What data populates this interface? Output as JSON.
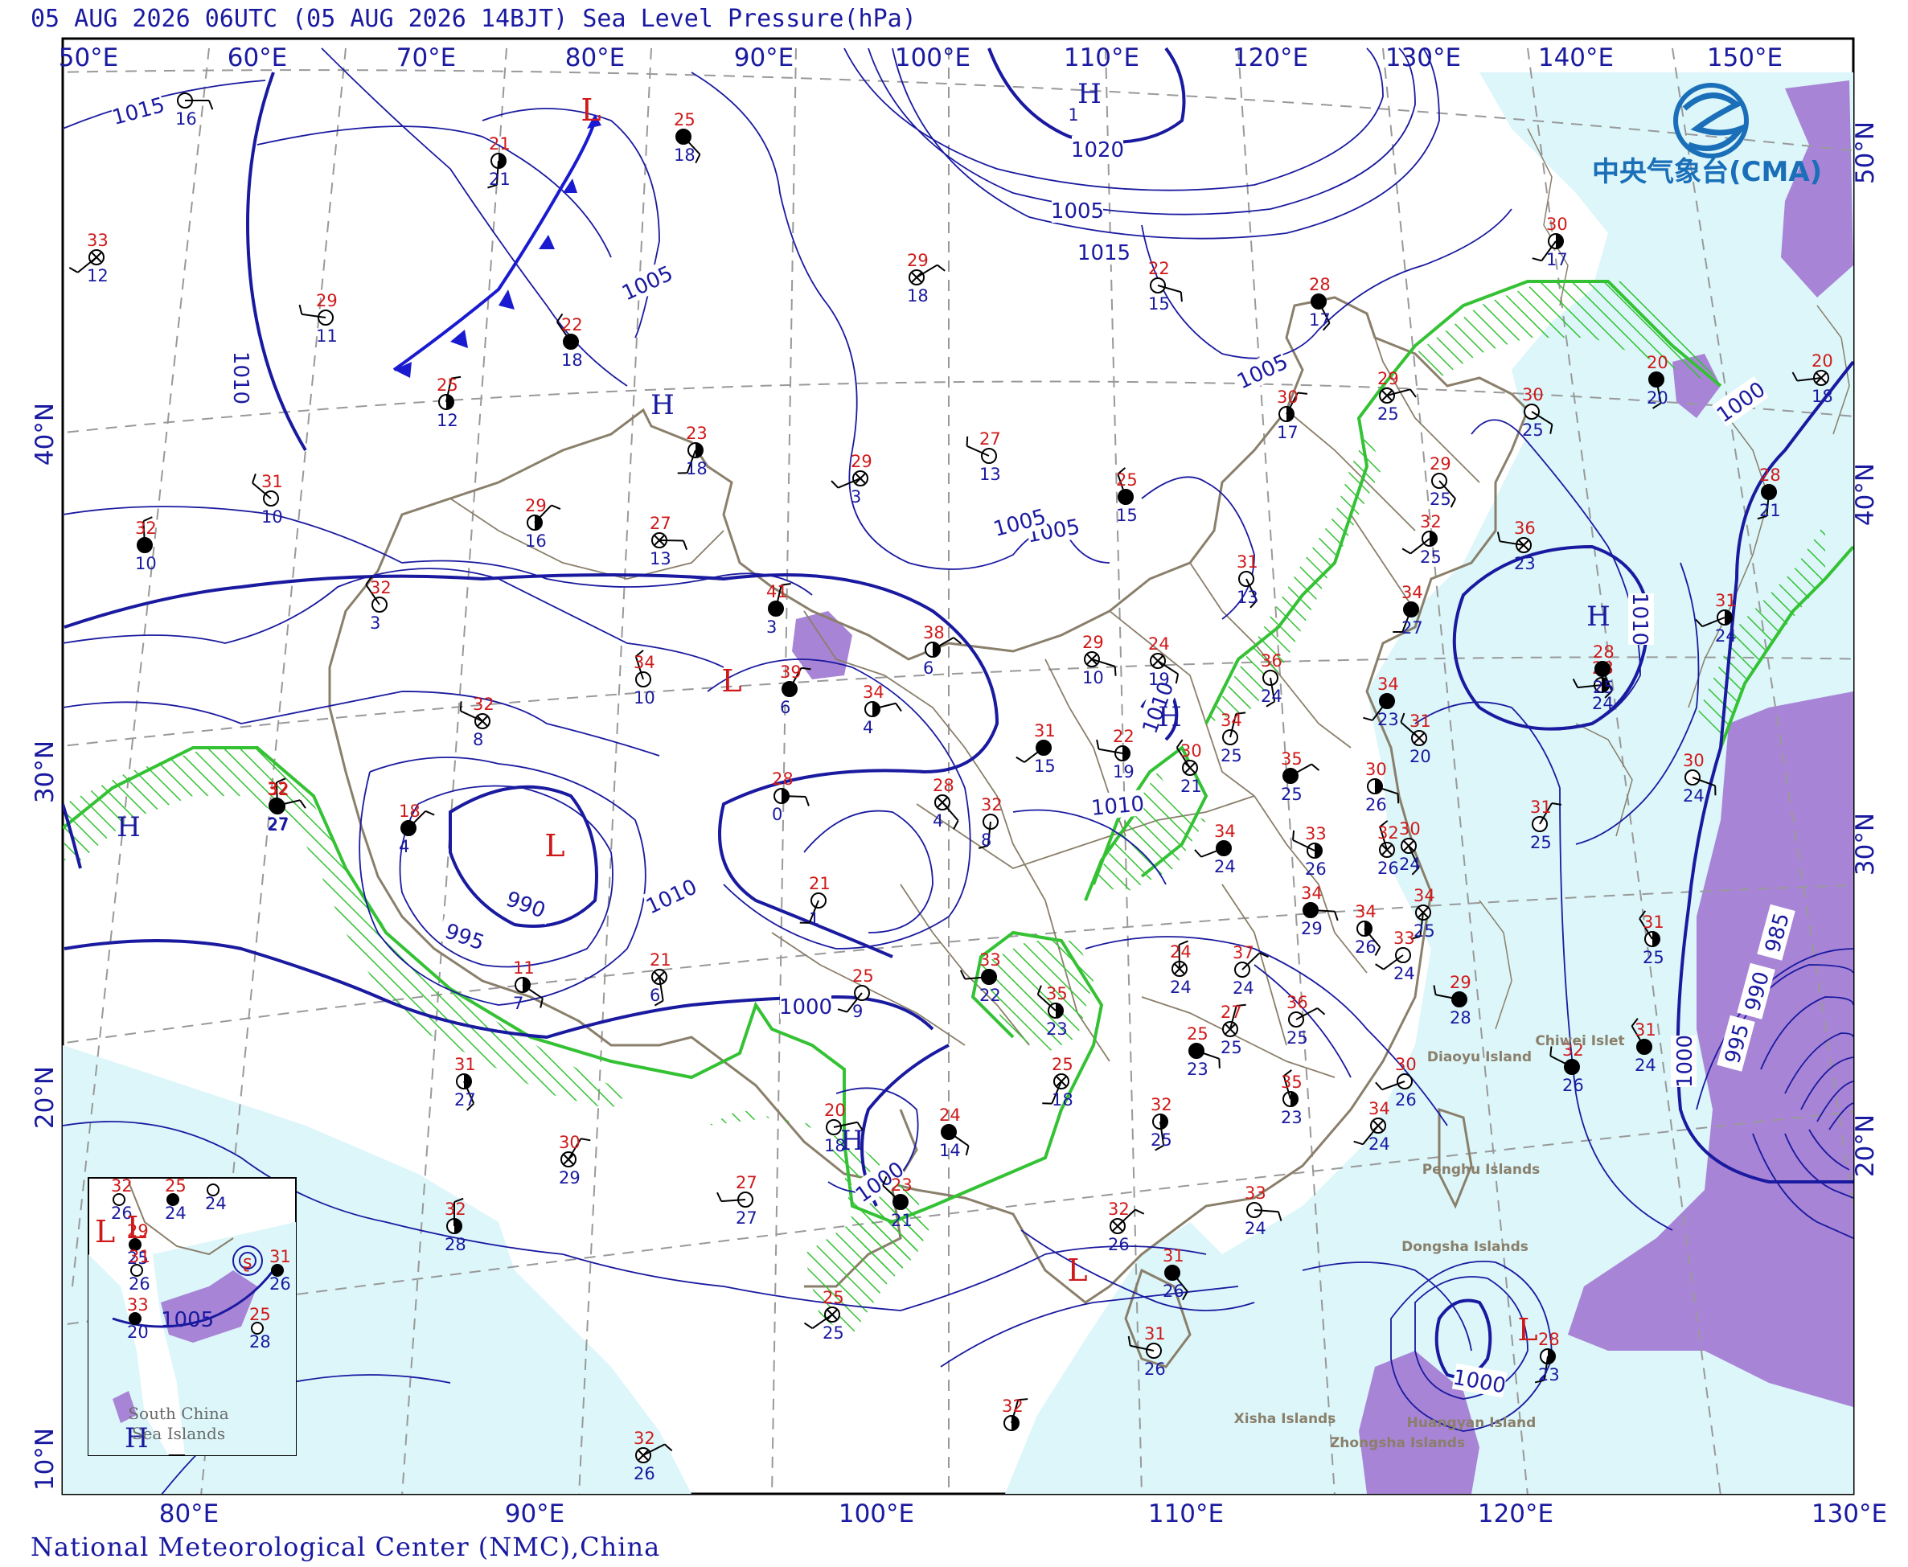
{
  "header": {
    "title": "05 AUG 2026 06UTC (05 AUG 2026 14BJT) Sea Level Pressure(hPa)"
  },
  "footer": {
    "credit": "National Meteorological Center (NMC),China"
  },
  "logo": {
    "text": "中央气象台(CMA)",
    "icon": "cma-emblem-icon"
  },
  "axes": {
    "top_lon": [
      "50°E",
      "60°E",
      "70°E",
      "80°E",
      "90°E",
      "100°E",
      "110°E",
      "120°E",
      "130°E",
      "140°E",
      "150°E"
    ],
    "bottom_lon": [
      "80°E",
      "90°E",
      "100°E",
      "110°E",
      "120°E",
      "130°E"
    ],
    "left_lat": [
      "10°N",
      "20°N",
      "30°N",
      "40°N"
    ],
    "right_lat": [
      "20°N",
      "30°N",
      "40°N",
      "50°N"
    ]
  },
  "isobar_labels": [
    "1015",
    "1010",
    "1005",
    "1020",
    "1015",
    "1010",
    "1005",
    "1005",
    "1010",
    "1010",
    "990",
    "995",
    "1000",
    "1000",
    "1005",
    "1000",
    "1000",
    "995",
    "990",
    "985",
    "1010",
    "1000",
    "1005"
  ],
  "pressure_centers": [
    {
      "type": "L",
      "value": ""
    },
    {
      "type": "H",
      "value": "1"
    },
    {
      "type": "H",
      "value": ""
    },
    {
      "type": "L",
      "value": ""
    },
    {
      "type": "L",
      "value": ""
    },
    {
      "type": "H",
      "value": ""
    },
    {
      "type": "H",
      "value": ""
    },
    {
      "type": "H",
      "value": ""
    },
    {
      "type": "L",
      "value": ""
    },
    {
      "type": "H",
      "value": ""
    },
    {
      "type": "L",
      "value": ""
    },
    {
      "type": "L",
      "value": ""
    }
  ],
  "stations": [
    {
      "t": "",
      "d": "16"
    },
    {
      "t": "25",
      "d": "18"
    },
    {
      "t": "21",
      "d": "21"
    },
    {
      "t": "33",
      "d": "12"
    },
    {
      "t": "29",
      "d": "11"
    },
    {
      "t": "22",
      "d": "18"
    },
    {
      "t": "25",
      "d": "12"
    },
    {
      "t": "29",
      "d": "18"
    },
    {
      "t": "22",
      "d": "15"
    },
    {
      "t": "28",
      "d": "17"
    },
    {
      "t": "23",
      "d": "18"
    },
    {
      "t": "29",
      "d": "3"
    },
    {
      "t": "27",
      "d": "13"
    },
    {
      "t": "25",
      "d": "15"
    },
    {
      "t": "30",
      "d": "17"
    },
    {
      "t": "29",
      "d": "25"
    },
    {
      "t": "30",
      "d": "25"
    },
    {
      "t": "20",
      "d": "20"
    },
    {
      "t": "30",
      "d": "17"
    },
    {
      "t": "20",
      "d": "18"
    },
    {
      "t": "31",
      "d": "10"
    },
    {
      "t": "32",
      "d": "10"
    },
    {
      "t": "29",
      "d": "16"
    },
    {
      "t": "27",
      "d": "13"
    },
    {
      "t": "29",
      "d": "25"
    },
    {
      "t": "28",
      "d": "21"
    },
    {
      "t": "32",
      "d": "25"
    },
    {
      "t": "36",
      "d": "23"
    },
    {
      "t": "32",
      "d": "3"
    },
    {
      "t": "41",
      "d": "3"
    },
    {
      "t": "38",
      "d": "6"
    },
    {
      "t": "29",
      "d": "10"
    },
    {
      "t": "31",
      "d": "13"
    },
    {
      "t": "34",
      "d": "27"
    },
    {
      "t": "31",
      "d": "24"
    },
    {
      "t": "32",
      "d": "8"
    },
    {
      "t": "34",
      "d": "10"
    },
    {
      "t": "39",
      "d": "6"
    },
    {
      "t": "34",
      "d": "4"
    },
    {
      "t": "24",
      "d": "19"
    },
    {
      "t": "36",
      "d": "24"
    },
    {
      "t": "34",
      "d": "23"
    },
    {
      "t": "28",
      "d": "24"
    },
    {
      "t": "31",
      "d": "20"
    },
    {
      "t": "32",
      "d": "27"
    },
    {
      "t": "18",
      "d": "4"
    },
    {
      "t": "28",
      "d": "0"
    },
    {
      "t": "28",
      "d": "4"
    },
    {
      "t": "32",
      "d": "8"
    },
    {
      "t": "31",
      "d": "15"
    },
    {
      "t": "22",
      "d": "19"
    },
    {
      "t": "30",
      "d": "21"
    },
    {
      "t": "34",
      "d": "25"
    },
    {
      "t": "35",
      "d": "25"
    },
    {
      "t": "30",
      "d": "26"
    },
    {
      "t": "30",
      "d": "24"
    },
    {
      "t": "21",
      "d": "1"
    },
    {
      "t": "34",
      "d": "24"
    },
    {
      "t": "33",
      "d": "26"
    },
    {
      "t": "32",
      "d": "26"
    },
    {
      "t": "31",
      "d": "25"
    },
    {
      "t": "32",
      "d": "27"
    },
    {
      "t": "11",
      "d": "7"
    },
    {
      "t": "21",
      "d": "6"
    },
    {
      "t": "25",
      "d": "9"
    },
    {
      "t": "33",
      "d": "22"
    },
    {
      "t": "35",
      "d": "23"
    },
    {
      "t": "24",
      "d": "24"
    },
    {
      "t": "37",
      "d": "24"
    },
    {
      "t": "34",
      "d": "29"
    },
    {
      "t": "34",
      "d": "26"
    },
    {
      "t": "34",
      "d": "25"
    },
    {
      "t": "33",
      "d": "24"
    },
    {
      "t": "29",
      "d": "28"
    },
    {
      "t": "31",
      "d": "25"
    },
    {
      "t": "27",
      "d": "25"
    },
    {
      "t": "36",
      "d": "25"
    },
    {
      "t": "25",
      "d": "23"
    },
    {
      "t": "31",
      "d": "27"
    },
    {
      "t": "25",
      "d": "18"
    },
    {
      "t": "30",
      "d": "26"
    },
    {
      "t": "32",
      "d": "26"
    },
    {
      "t": "35",
      "d": "23"
    },
    {
      "t": "30",
      "d": "29"
    },
    {
      "t": "20",
      "d": "18"
    },
    {
      "t": "24",
      "d": "14"
    },
    {
      "t": "32",
      "d": "25"
    },
    {
      "t": "34",
      "d": "24"
    },
    {
      "t": "27",
      "d": "27"
    },
    {
      "t": "23",
      "d": "21"
    },
    {
      "t": "32",
      "d": "28"
    },
    {
      "t": "32",
      "d": "26"
    },
    {
      "t": "33",
      "d": "24"
    },
    {
      "t": "31",
      "d": "26"
    },
    {
      "t": "28",
      "d": "23"
    },
    {
      "t": "25",
      "d": "25"
    },
    {
      "t": "31",
      "d": "26"
    },
    {
      "t": "31",
      "d": "24"
    },
    {
      "t": "32",
      "d": ""
    },
    {
      "t": "32",
      "d": "26"
    },
    {
      "t": "30",
      "d": "24"
    },
    {
      "t": "28",
      "d": "25"
    }
  ],
  "islands": [
    "Chiwei Islet",
    "Diaoyu Island",
    "Penghu Islands",
    "Dongsha Islands",
    "Xisha Islands",
    "Zhongsha Islands",
    "Huangyan Island"
  ],
  "inset": {
    "label_line1": "South China",
    "label_line2": "Sea Islands",
    "isobar_label": "1005",
    "center_L": "L",
    "center_H": "H",
    "stations": [
      {
        "t": "32",
        "d": "26"
      },
      {
        "t": "25",
        "d": "24"
      },
      {
        "t": "",
        "d": "24"
      },
      {
        "t": "29",
        "d": "25"
      },
      {
        "t": "31",
        "d": "26"
      },
      {
        "t": "33",
        "d": "20"
      },
      {
        "t": "25",
        "d": "28"
      },
      {
        "t": "31",
        "d": "26"
      }
    ]
  },
  "colors": {
    "isobar": "#1a1aa0",
    "land_border": "#8a7f6a",
    "sea": "#dcf6fa",
    "precip_area": "#a884d6",
    "green_front": "#34c234",
    "cold_front": "#1a1ad0",
    "temperature": "#d01a1a",
    "dewpoint": "#1a1aa0"
  }
}
